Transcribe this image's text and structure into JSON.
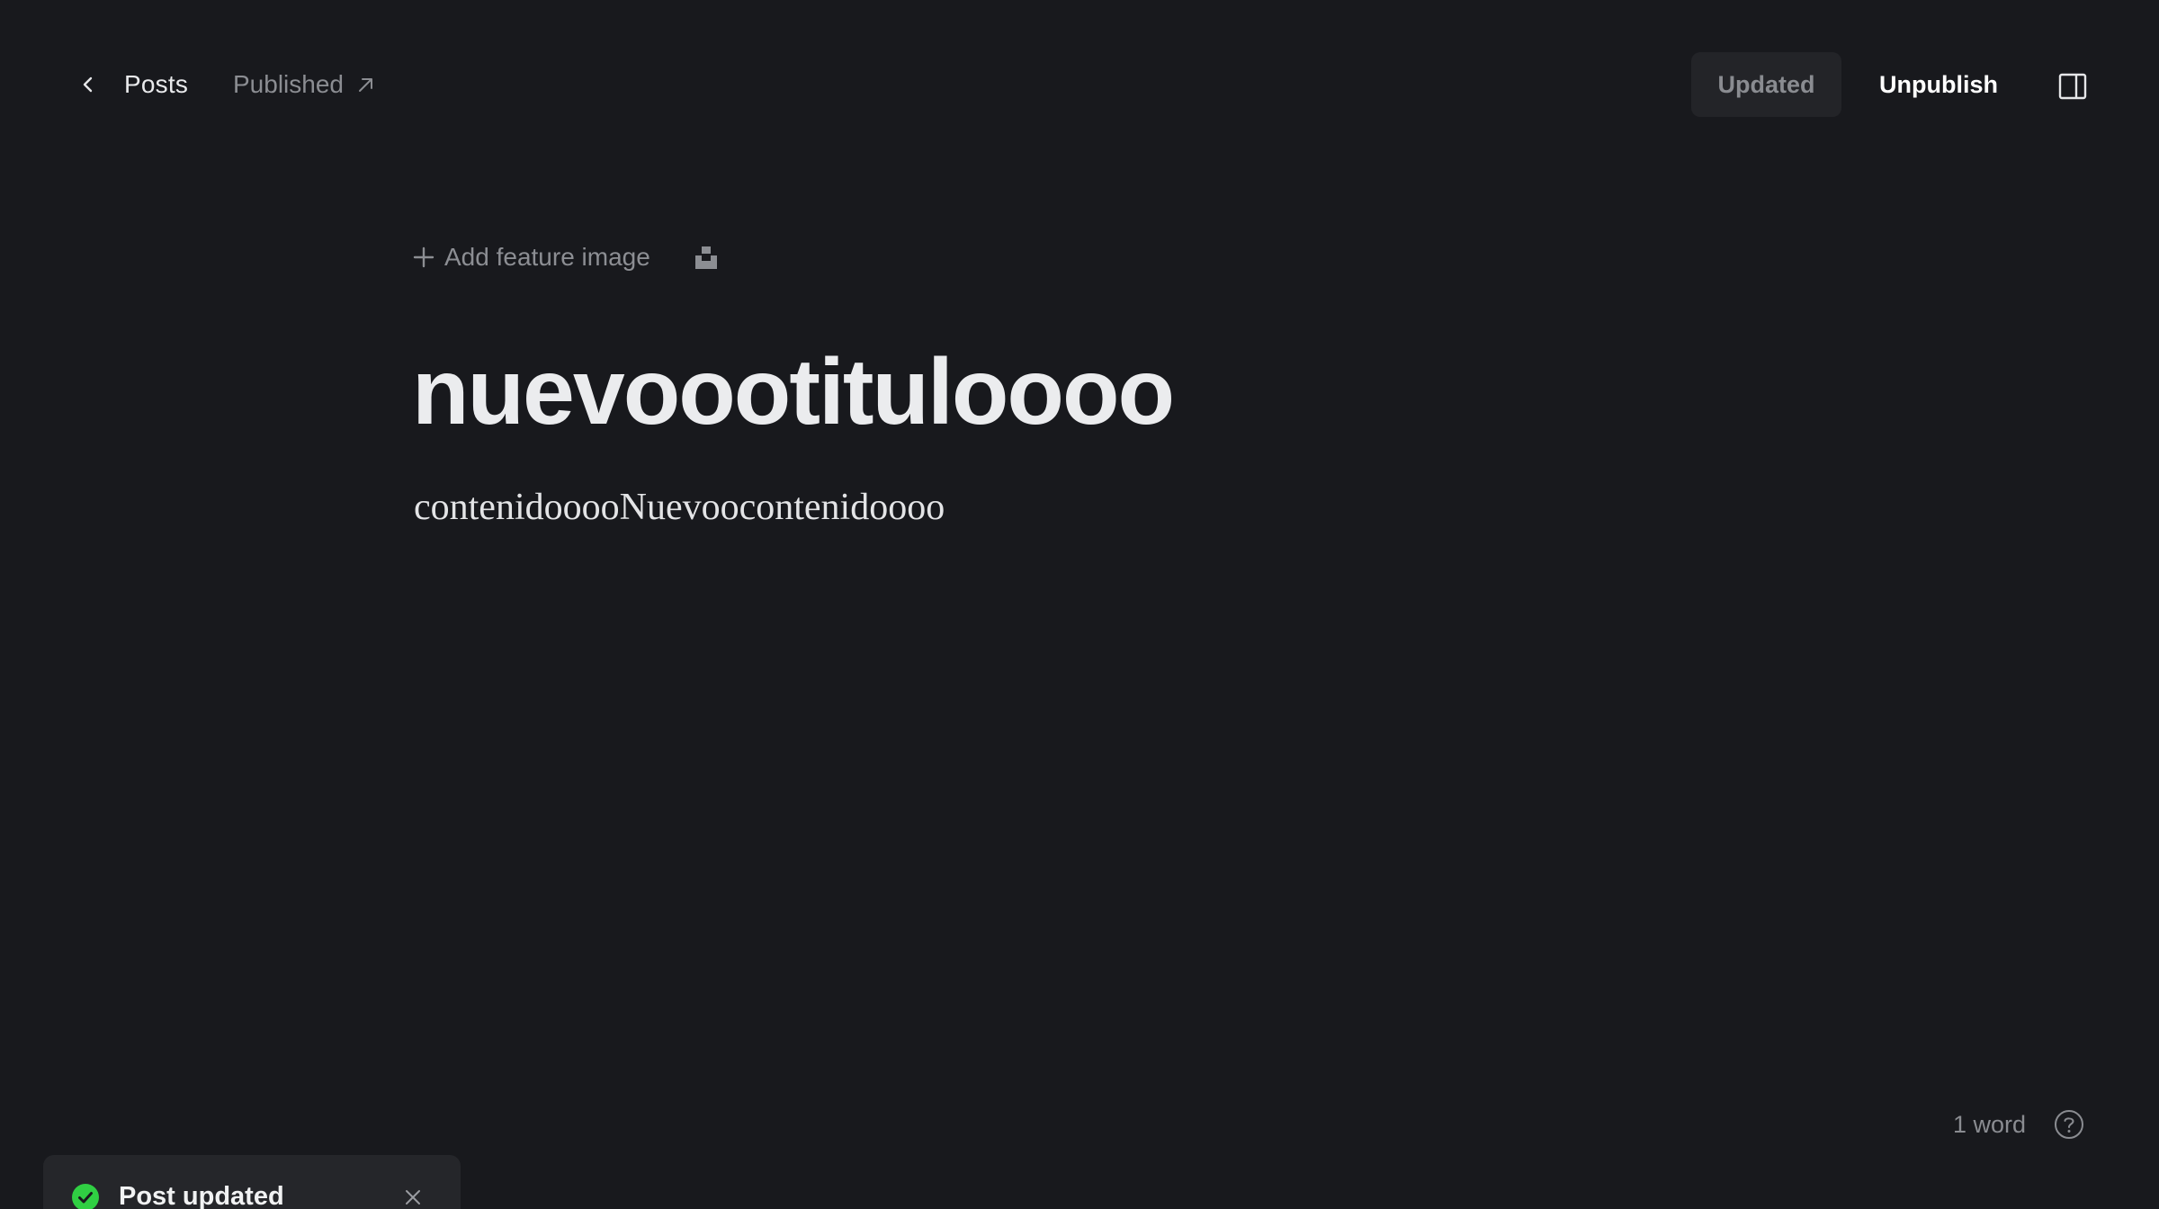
{
  "header": {
    "back_label": "Posts",
    "status_label": "Published",
    "saved_state_label": "Updated",
    "unpublish_label": "Unpublish"
  },
  "editor": {
    "add_feature_image_label": "Add feature image",
    "title": "nuevoootituloooo",
    "body": "contenidooooNuevoocontenidoooo"
  },
  "footer": {
    "word_count": "1 word"
  },
  "toast": {
    "message": "Post updated"
  },
  "colors": {
    "background": "#18191d",
    "success": "#30cf43"
  },
  "icons": {
    "back": "chevron-left-icon",
    "status_link": "arrow-up-right-icon",
    "sidebar": "sidebar-panel-icon",
    "add": "plus-icon",
    "unsplash": "unsplash-icon",
    "help": "question-circle-icon",
    "success": "check-circle-icon",
    "close": "close-icon"
  }
}
